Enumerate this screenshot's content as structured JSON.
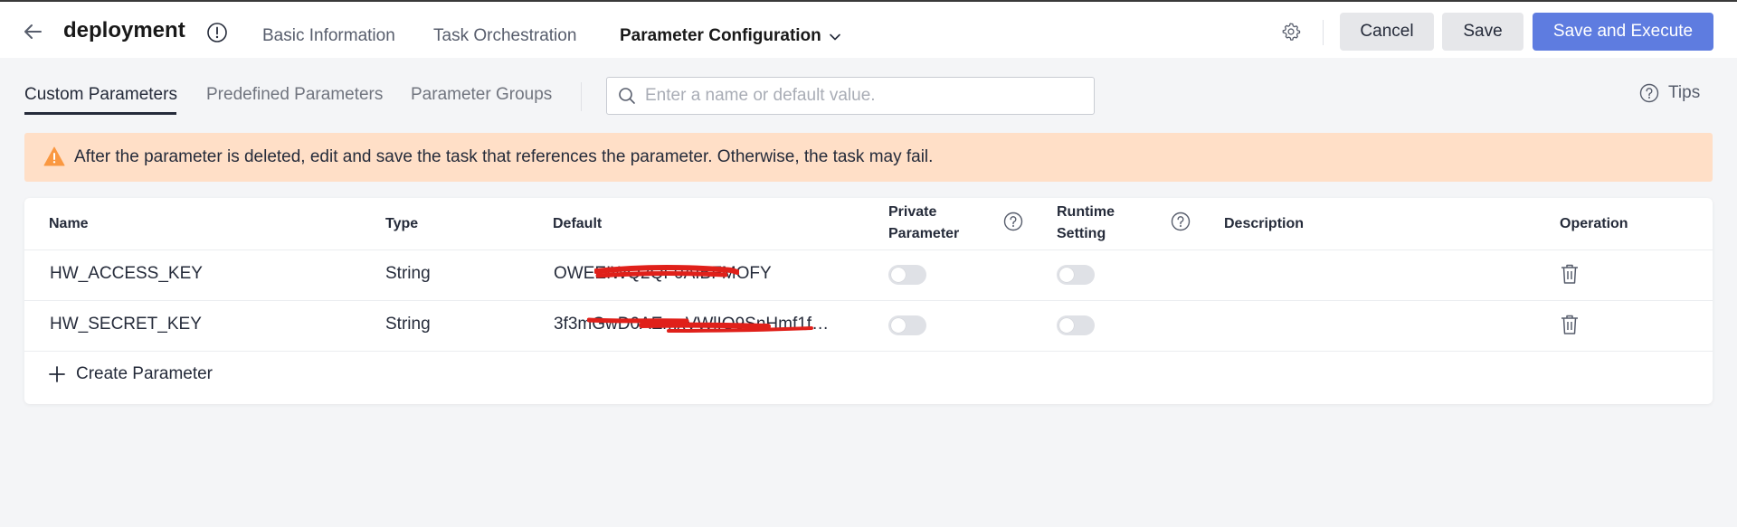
{
  "header": {
    "title": "deployment",
    "tabs": [
      {
        "label": "Basic Information"
      },
      {
        "label": "Task Orchestration"
      },
      {
        "label": "Parameter Configuration"
      }
    ],
    "buttons": {
      "cancel": "Cancel",
      "save": "Save",
      "save_execute": "Save and Execute"
    }
  },
  "subtabs": [
    {
      "label": "Custom Parameters"
    },
    {
      "label": "Predefined Parameters"
    },
    {
      "label": "Parameter Groups"
    }
  ],
  "search": {
    "placeholder": "Enter a name or default value.",
    "value": ""
  },
  "tips": {
    "label": "Tips"
  },
  "alert": {
    "text": "After the parameter is deleted, edit and save the task that references the parameter. Otherwise, the task may fail."
  },
  "table": {
    "columns": {
      "name": "Name",
      "type": "Type",
      "default": "Default",
      "private_line1": "Private",
      "private_line2": "Parameter",
      "runtime_line1": "Runtime",
      "runtime_line2": "Setting",
      "description": "Description",
      "operation": "Operation"
    },
    "rows": [
      {
        "name": "HW_ACCESS_KEY",
        "type": "String",
        "default": "OWEEIWQ2QF0AIBFMOFY",
        "private": false,
        "runtime": false,
        "description": ""
      },
      {
        "name": "HW_SECRET_KEY",
        "type": "String",
        "default": "3f3mGwD0AEmxVWlIO9SnHmf1f…",
        "private": false,
        "runtime": false,
        "description": ""
      }
    ],
    "create_label": "Create Parameter"
  },
  "colors": {
    "primary": "#5e7ce0",
    "alert_bg": "#ffdfc7",
    "warning": "#fa9841",
    "redaction": "#e0201a"
  },
  "icons": [
    "back-arrow-icon",
    "info-icon",
    "chevron-down-icon",
    "gear-icon",
    "search-icon",
    "help-icon",
    "warning-icon",
    "trash-icon",
    "plus-icon"
  ]
}
